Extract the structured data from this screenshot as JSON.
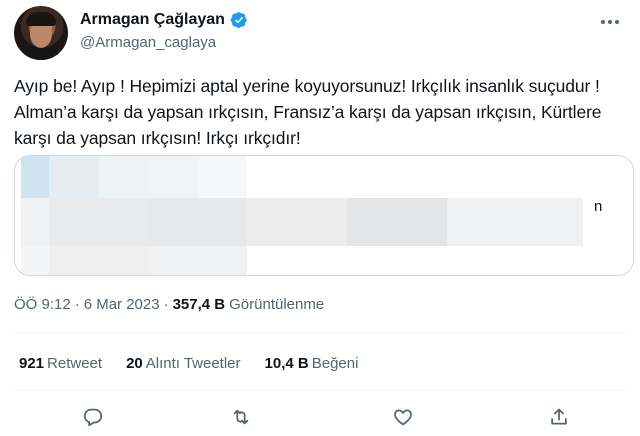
{
  "author": {
    "display_name": "Armagan Çağlayan",
    "handle": "@Armagan_caglaya",
    "verified": true,
    "avatar_icon": "profile-photo"
  },
  "tweet": {
    "text": "Ayıp be! Ayıp ! Hepimizi aptal yerine koyuyorsunuz! Irkçılık insanlık suçudur ! Alman’a karşı da yapsan ırkçısın, Fransız’a karşı da yapsan ırkçısın, Kürtlere karşı da yapsan ırkçısın! Irkçı ırkçıdır!"
  },
  "quoted_tweet": {
    "visible_text": "n"
  },
  "meta": {
    "time": "ÖÖ 9:12",
    "separator": "·",
    "date": "6 Mar 2023",
    "views_count": "357,4 B",
    "views_label": "Görüntülenme"
  },
  "stats": {
    "retweets": {
      "count": "921",
      "label": "Retweet"
    },
    "quotes": {
      "count": "20",
      "label": "Alıntı Tweetler"
    },
    "likes": {
      "count": "10,4 B",
      "label": "Beğeni"
    }
  },
  "actions": [
    "reply-icon",
    "retweet-icon",
    "like-icon",
    "share-icon"
  ],
  "colors": {
    "text": "#0f1419",
    "secondary": "#536471",
    "verified": "#1d9bf0",
    "border": "#cfd9de"
  }
}
